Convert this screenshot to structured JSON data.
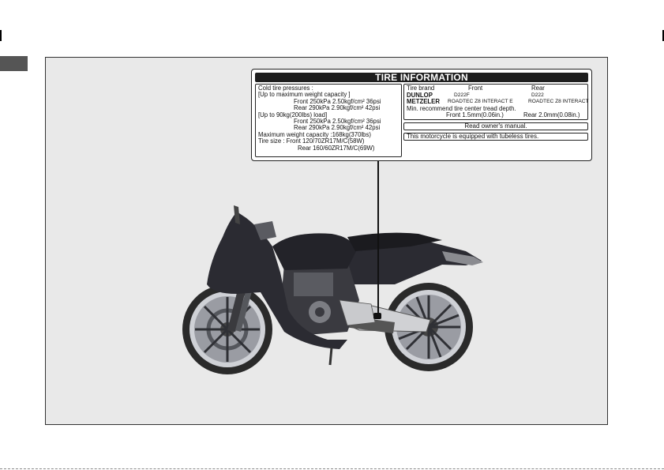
{
  "label": {
    "title": "TIRE INFORMATION",
    "pressures": {
      "heading": "Cold  tire  pressures :",
      "max_load": "[Up  to maximum  weight  capacity ]",
      "max_front": "Front   250kPa 2.50kgf/cm² 36psi",
      "max_rear": "Rear   290kPa 2.90kgf/cm² 42psi",
      "light_load": "[Up to 90kg(200lbs) load]",
      "light_front": "Front   250kPa 2.50kgf/cm² 36psi",
      "light_rear": "Rear   290kPa 2.90kgf/cm² 42psi",
      "weight_capacity": "Maximum  weight  capacity :168kg(370lbs)",
      "size_front": "Tire  size :  Front  120/70ZR17M/C(58W)",
      "size_rear": "Rear   160/60ZR17M/C(69W)"
    },
    "brands": {
      "header_brand": "Tire  brand",
      "header_front": "Front",
      "header_rear": "Rear",
      "dunlop_name": "DUNLOP",
      "dunlop_front": "D222F",
      "dunlop_rear": "D222",
      "metzeler_name": "METZELER",
      "metzeler_front": "ROADTEC  Z8  INTERACT  E",
      "metzeler_rear": "ROADTEC  Z8  INTERACT",
      "tread_heading": "Min.  recommend  tire  center   tread  depth.",
      "tread_front": "Front  1.5mm(0.06in.)",
      "tread_rear": "Rear   2.0mm(0.08in.)"
    },
    "notice_manual": "Read  owner's  manual.",
    "notice_tubeless": "This motorcycle  is  equipped  with  tubeless  tires."
  },
  "colors": {
    "panel": "#e9e9e9",
    "title_bar": "#1e1e1e",
    "side_tab": "#555555",
    "bike_body": "#2b2b32"
  }
}
